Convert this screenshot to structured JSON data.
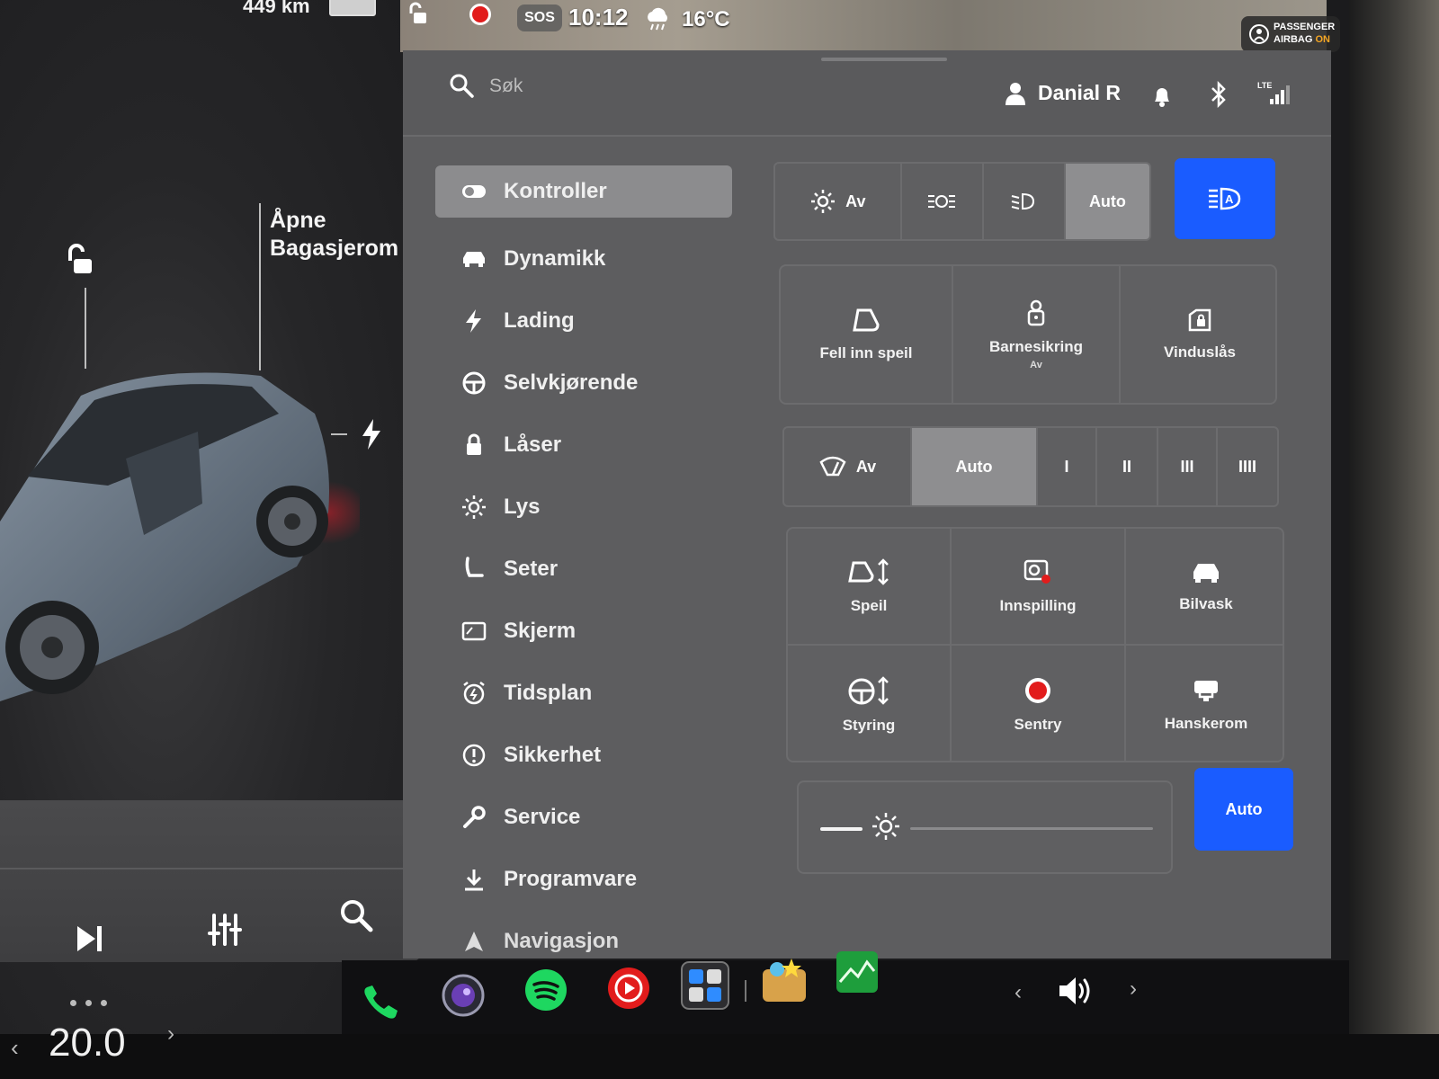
{
  "status_bar": {
    "range": "449 km",
    "sos": "SOS",
    "time": "10:12",
    "temperature": "16°C",
    "airbag_line1": "PASSENGER",
    "airbag_line2": "AIRBAG",
    "airbag_state": "ON"
  },
  "car_panel": {
    "trunk_label_line1": "Åpne",
    "trunk_label_line2": "Bagasjerom",
    "lock_icon": "unlock-icon",
    "charge_icon": "lightning-icon"
  },
  "media": {
    "controls": [
      "next-track-icon",
      "equalizer-icon",
      "search-icon"
    ]
  },
  "climate": {
    "temperature": "20.0"
  },
  "header": {
    "search_placeholder": "Søk",
    "profile_name": "Danial R"
  },
  "sidebar": {
    "items": [
      {
        "label": "Kontroller",
        "icon": "toggle-icon",
        "active": true
      },
      {
        "label": "Dynamikk",
        "icon": "car-icon"
      },
      {
        "label": "Lading",
        "icon": "lightning-icon"
      },
      {
        "label": "Selvkjørende",
        "icon": "steering-wheel-icon"
      },
      {
        "label": "Låser",
        "icon": "lock-icon"
      },
      {
        "label": "Lys",
        "icon": "sun-icon"
      },
      {
        "label": "Seter",
        "icon": "seat-icon"
      },
      {
        "label": "Skjerm",
        "icon": "display-icon"
      },
      {
        "label": "Tidsplan",
        "icon": "alarm-clock-icon"
      },
      {
        "label": "Sikkerhet",
        "icon": "alert-circle-icon"
      },
      {
        "label": "Service",
        "icon": "wrench-icon"
      },
      {
        "label": "Programvare",
        "icon": "download-icon"
      },
      {
        "label": "Navigasjon",
        "icon": "navigation-arrow-icon"
      }
    ]
  },
  "controls": {
    "lights": {
      "off_label": "Av",
      "auto_label": "Auto",
      "selected": "Auto"
    },
    "tiles_row1": [
      {
        "label": "Fell inn speil",
        "icon": "mirror-fold-icon"
      },
      {
        "label": "Barnesikring",
        "sub": "Av",
        "icon": "child-lock-icon"
      },
      {
        "label": "Vinduslås",
        "icon": "window-lock-icon"
      }
    ],
    "wipers": {
      "off_label": "Av",
      "auto_label": "Auto",
      "speeds": [
        "I",
        "II",
        "III",
        "IIII"
      ],
      "selected": "Auto"
    },
    "tiles_grid": [
      {
        "label": "Speil",
        "icon": "mirror-adjust-icon"
      },
      {
        "label": "Innspilling",
        "icon": "dashcam-icon"
      },
      {
        "label": "Bilvask",
        "icon": "car-wash-icon"
      },
      {
        "label": "Styring",
        "icon": "steering-adjust-icon"
      },
      {
        "label": "Sentry",
        "icon": "sentry-icon"
      },
      {
        "label": "Hanskerom",
        "icon": "glovebox-icon"
      }
    ],
    "brightness": {
      "level": 0.1,
      "auto_label": "Auto"
    }
  },
  "dock": {
    "apps": [
      "phone-icon",
      "camera-app-icon",
      "spotify-icon",
      "media-player-icon",
      "controls-app-icon",
      "toybox-icon",
      "stocks-app-icon"
    ]
  },
  "colors": {
    "accent_blue": "#1a5cff",
    "record_red": "#e21c1c",
    "spotify_green": "#1ed760"
  }
}
